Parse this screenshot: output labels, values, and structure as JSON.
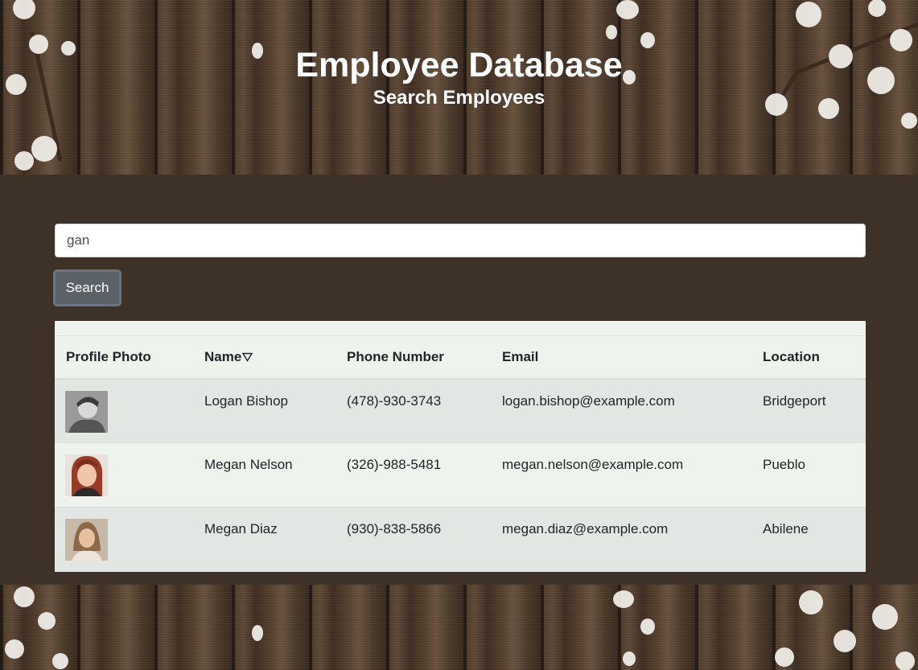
{
  "header": {
    "title": "Employee Database",
    "subtitle": "Search Employees"
  },
  "search": {
    "value": "gan",
    "button_label": "Search"
  },
  "table": {
    "columns": [
      "Profile Photo",
      "Name",
      "Phone Number",
      "Email",
      "Location"
    ],
    "sort_icon": "triangle-down-icon",
    "rows": [
      {
        "name": "Logan Bishop",
        "phone": "(478)-930-3743",
        "email": "logan.bishop@example.com",
        "location": "Bridgeport"
      },
      {
        "name": "Megan Nelson",
        "phone": "(326)-988-5481",
        "email": "megan.nelson@example.com",
        "location": "Pueblo"
      },
      {
        "name": "Megan Diaz",
        "phone": "(930)-838-5866",
        "email": "megan.diaz@example.com",
        "location": "Abilene"
      }
    ]
  },
  "colors": {
    "page_background": "#3e3128",
    "table_background": "#eef3ee",
    "button_background": "#5a6268"
  }
}
